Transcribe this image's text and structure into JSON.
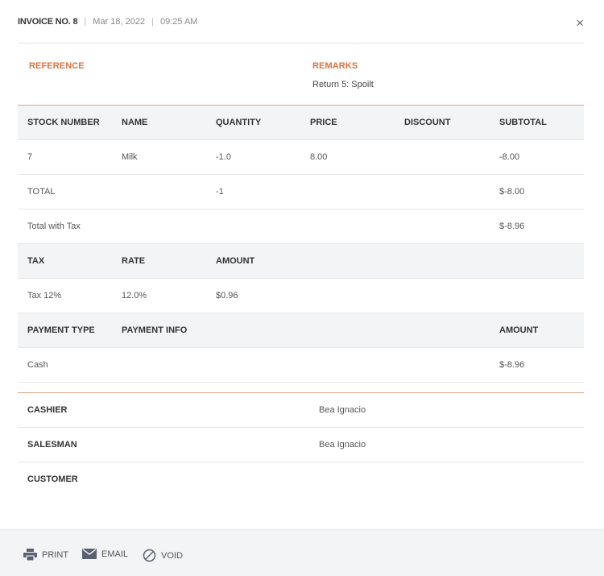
{
  "header": {
    "invoice_no": "INVOICE NO. 8",
    "date": "Mar 18, 2022",
    "time": "09:25 AM",
    "separator": "|",
    "close": "×"
  },
  "reference": {
    "label": "REFERENCE",
    "value": ""
  },
  "remarks": {
    "label": "REMARKS",
    "value": "Return 5: Spoilt"
  },
  "items": {
    "headers": [
      "STOCK NUMBER",
      "NAME",
      "QUANTITY",
      "PRICE",
      "DISCOUNT",
      "SUBTOTAL"
    ],
    "rows": [
      [
        "7",
        "Milk",
        "-1.0",
        "8.00",
        "",
        "-8.00"
      ]
    ],
    "total": {
      "label": "TOTAL",
      "quantity": "-1",
      "subtotal": "$-8.00"
    },
    "total_with_tax": {
      "label": "Total with Tax",
      "subtotal": "$-8.96"
    }
  },
  "tax": {
    "headers": [
      "TAX",
      "RATE",
      "AMOUNT"
    ],
    "rows": [
      [
        "Tax 12%",
        "12.0%",
        "$0.96"
      ]
    ]
  },
  "payment": {
    "headers": [
      "PAYMENT TYPE",
      "PAYMENT INFO",
      "AMOUNT"
    ],
    "rows": [
      [
        "Cash",
        "",
        "$-8.96"
      ]
    ]
  },
  "staff": {
    "cashier": {
      "label": "CASHIER",
      "value": "Bea Ignacio"
    },
    "salesman": {
      "label": "SALESMAN",
      "value": "Bea Ignacio"
    },
    "customer": {
      "label": "CUSTOMER",
      "value": ""
    }
  },
  "footer": {
    "print": "PRINT",
    "email": "EMAIL",
    "void": "VOID"
  },
  "colors": {
    "accent": "#d9733c",
    "divider": "#d9a98a",
    "head_bg": "#f3f4f6",
    "icon": "#5a6270"
  },
  "icons": {
    "close": "close-icon",
    "print": "printer-icon",
    "email": "envelope-icon",
    "void": "void-circle-icon"
  }
}
